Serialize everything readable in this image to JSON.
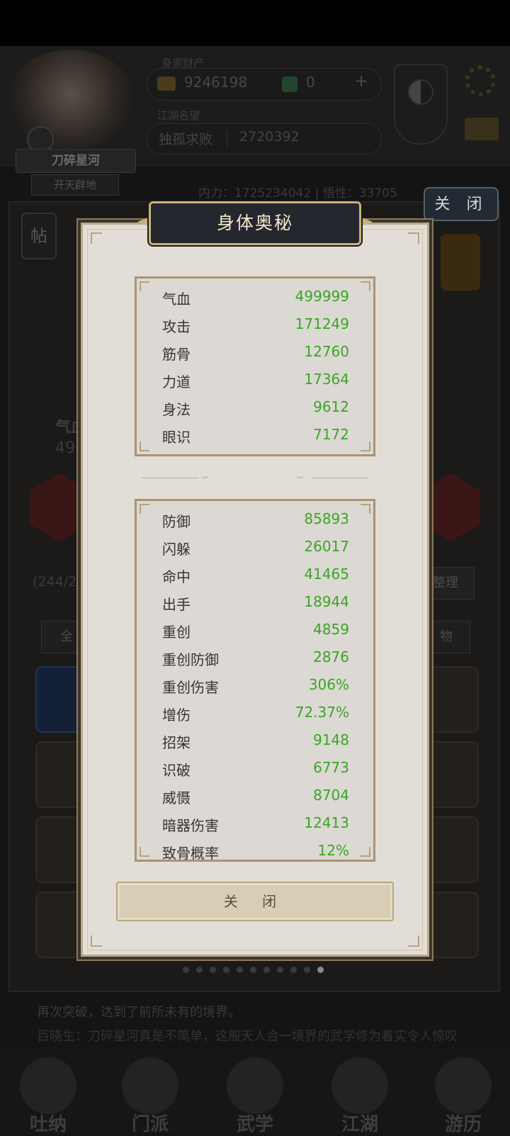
{
  "header": {
    "label_money": "身家财产",
    "coins": "9246198",
    "jade": "0",
    "plus": "+",
    "label_rank": "江湖名望",
    "rank_name": "独孤求败",
    "rank_value": "2720392",
    "player_name": "刀碎星河",
    "player_title": "开天辟地",
    "stat_strip": "内力：1725234042 | 悟性：33705"
  },
  "background": {
    "tie_label": "帖",
    "left_qi_label": "气血",
    "left_qi_value": "49",
    "bag_count": "(244/2",
    "sort_btn": "整理",
    "all_btn": "全",
    "wu_btn": "物",
    "story_line1": "再次突破，达到了前所未有的境界。",
    "story_line2": "百晓生：刀碎星河真是不简单，这般天人合一境界的武学修为着实令人惊叹",
    "nav": [
      "吐纳",
      "门派",
      "武学",
      "江湖",
      "游历"
    ],
    "page_dots_total": 11,
    "page_dot_active": 10
  },
  "outer_close": "关 闭",
  "modal": {
    "title": "身体奥秘",
    "panel1": [
      {
        "k": "气血",
        "v": "499999"
      },
      {
        "k": "攻击",
        "v": "171249"
      },
      {
        "k": "筋骨",
        "v": "12760"
      },
      {
        "k": "力道",
        "v": "17364"
      },
      {
        "k": "身法",
        "v": "9612"
      },
      {
        "k": "眼识",
        "v": "7172"
      }
    ],
    "panel2": [
      {
        "k": "防御",
        "v": "85893"
      },
      {
        "k": "闪躲",
        "v": "26017"
      },
      {
        "k": "命中",
        "v": "41465"
      },
      {
        "k": "出手",
        "v": "18944"
      },
      {
        "k": "重创",
        "v": "4859"
      },
      {
        "k": "重创防御",
        "v": "2876"
      },
      {
        "k": "重创伤害",
        "v": "306%"
      },
      {
        "k": "增伤",
        "v": "72.37%"
      },
      {
        "k": "招架",
        "v": "9148"
      },
      {
        "k": "识破",
        "v": "6773"
      },
      {
        "k": "威慑",
        "v": "8704"
      },
      {
        "k": "暗器伤害",
        "v": "12413"
      },
      {
        "k": "致骨概率",
        "v": "12%"
      }
    ],
    "close_label": "关 闭"
  },
  "colors": {
    "value_green": "#3aa625",
    "panel_border": "#a89472",
    "title_bg": "#25272f"
  }
}
